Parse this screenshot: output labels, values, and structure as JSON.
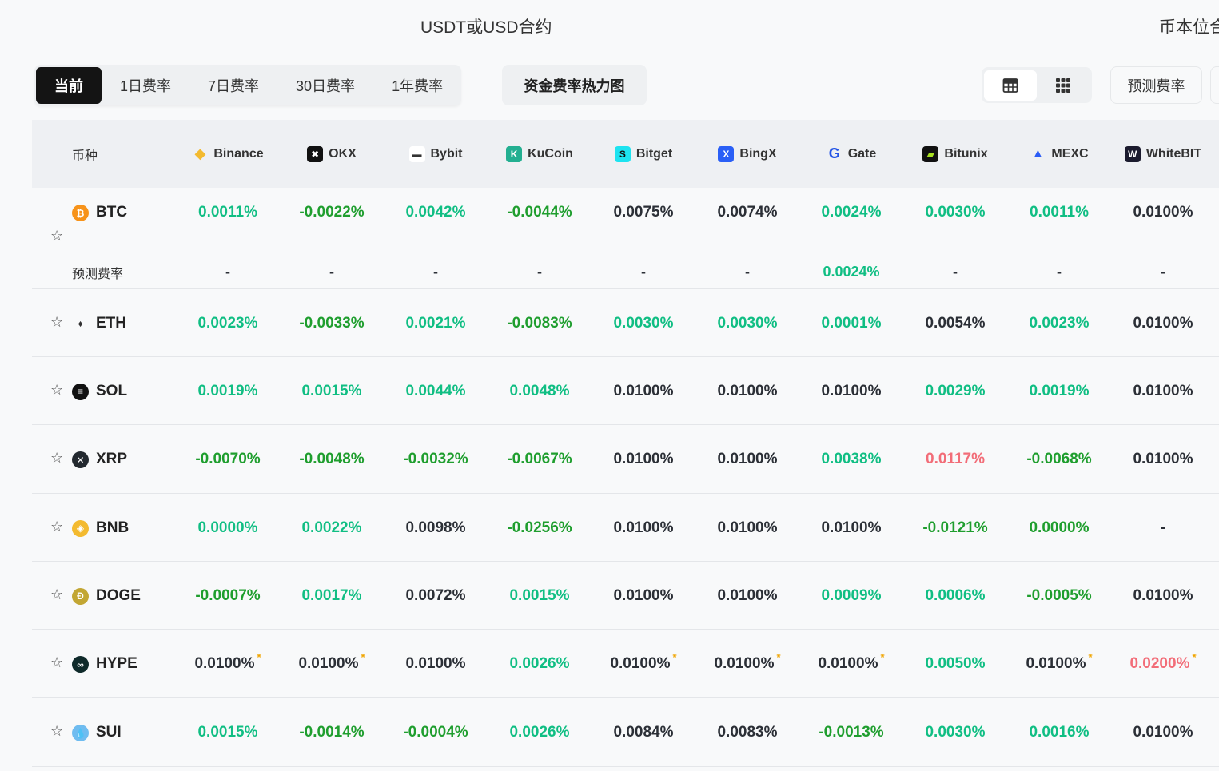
{
  "top_tabs": {
    "usdt": "USDT或USD合约",
    "coin": "币本位合"
  },
  "period_tabs": [
    "当前",
    "1日费率",
    "7日费率",
    "30日费率",
    "1年费率"
  ],
  "heatmap_button": "资金费率热力图",
  "view_icons": [
    "table-view-icon",
    "grid-view-icon"
  ],
  "predict_button": "预测费率",
  "header": {
    "coin": "币种"
  },
  "exchanges": [
    {
      "name": "Binance",
      "color": "#f3ba2f",
      "glyph": "◆"
    },
    {
      "name": "OKX",
      "color": "#111111",
      "glyph": "✖"
    },
    {
      "name": "Bybit",
      "color": "#ffffff",
      "glyph": "▬"
    },
    {
      "name": "KuCoin",
      "color": "#23af91",
      "glyph": "K"
    },
    {
      "name": "Bitget",
      "color": "#1de3f0",
      "glyph": "S"
    },
    {
      "name": "BingX",
      "color": "#2a5ff6",
      "glyph": "X"
    },
    {
      "name": "Gate",
      "color": "#2354e6",
      "glyph": "G"
    },
    {
      "name": "Bitunix",
      "color": "#111111",
      "glyph": "▰"
    },
    {
      "name": "MEXC",
      "color": "#2a5cf6",
      "glyph": "▲"
    },
    {
      "name": "WhiteBIT",
      "color": "#1b1b2e",
      "glyph": "W"
    }
  ],
  "colors": {
    "positive": "#10be83",
    "negative": "#1f9e2e",
    "neutral": "#2b2f36",
    "high": "#f26d78",
    "estimate_marker": "#f0a500"
  },
  "predict_label": "预测费率",
  "rows": [
    {
      "coin": "BTC",
      "icon": "₿",
      "icon_color": "#f7931a",
      "cells": [
        [
          "0.0011%",
          "p"
        ],
        [
          "-0.0022%",
          "n"
        ],
        [
          "0.0042%",
          "p"
        ],
        [
          "-0.0044%",
          "n"
        ],
        [
          "0.0075%",
          "u"
        ],
        [
          "0.0074%",
          "u"
        ],
        [
          "0.0024%",
          "p"
        ],
        [
          "0.0030%",
          "p"
        ],
        [
          "0.0011%",
          "p"
        ],
        [
          "0.0100%",
          "u"
        ]
      ],
      "predicted": [
        [
          "-",
          "u"
        ],
        [
          "-",
          "u"
        ],
        [
          "-",
          "u"
        ],
        [
          "-",
          "u"
        ],
        [
          "-",
          "u"
        ],
        [
          "-",
          "u"
        ],
        [
          "0.0024%",
          "p"
        ],
        [
          "-",
          "u"
        ],
        [
          "-",
          "u"
        ],
        [
          "-",
          "u"
        ]
      ]
    },
    {
      "coin": "ETH",
      "icon": "♦",
      "icon_color": "#f8f9fa",
      "cells": [
        [
          "0.0023%",
          "p"
        ],
        [
          "-0.0033%",
          "n"
        ],
        [
          "0.0021%",
          "p"
        ],
        [
          "-0.0083%",
          "n"
        ],
        [
          "0.0030%",
          "p"
        ],
        [
          "0.0030%",
          "p"
        ],
        [
          "0.0001%",
          "p"
        ],
        [
          "0.0054%",
          "u"
        ],
        [
          "0.0023%",
          "p"
        ],
        [
          "0.0100%",
          "u"
        ]
      ]
    },
    {
      "coin": "SOL",
      "icon": "≡",
      "icon_color": "#111111",
      "cells": [
        [
          "0.0019%",
          "p"
        ],
        [
          "0.0015%",
          "p"
        ],
        [
          "0.0044%",
          "p"
        ],
        [
          "0.0048%",
          "p"
        ],
        [
          "0.0100%",
          "u"
        ],
        [
          "0.0100%",
          "u"
        ],
        [
          "0.0100%",
          "u"
        ],
        [
          "0.0029%",
          "p"
        ],
        [
          "0.0019%",
          "p"
        ],
        [
          "0.0100%",
          "u"
        ]
      ]
    },
    {
      "coin": "XRP",
      "icon": "✕",
      "icon_color": "#23292f",
      "cells": [
        [
          "-0.0070%",
          "n"
        ],
        [
          "-0.0048%",
          "n"
        ],
        [
          "-0.0032%",
          "n"
        ],
        [
          "-0.0067%",
          "n"
        ],
        [
          "0.0100%",
          "u"
        ],
        [
          "0.0100%",
          "u"
        ],
        [
          "0.0038%",
          "p"
        ],
        [
          "0.0117%",
          "r"
        ],
        [
          "-0.0068%",
          "n"
        ],
        [
          "0.0100%",
          "u"
        ]
      ]
    },
    {
      "coin": "BNB",
      "icon": "◈",
      "icon_color": "#f3ba2f",
      "cells": [
        [
          "0.0000%",
          "p"
        ],
        [
          "0.0022%",
          "p"
        ],
        [
          "0.0098%",
          "u"
        ],
        [
          "-0.0256%",
          "n"
        ],
        [
          "0.0100%",
          "u"
        ],
        [
          "0.0100%",
          "u"
        ],
        [
          "0.0100%",
          "u"
        ],
        [
          "-0.0121%",
          "n"
        ],
        [
          "0.0000%",
          "n"
        ],
        [
          "-",
          "u"
        ]
      ]
    },
    {
      "coin": "DOGE",
      "icon": "Ð",
      "icon_color": "#c2a633",
      "cells": [
        [
          "-0.0007%",
          "n"
        ],
        [
          "0.0017%",
          "p"
        ],
        [
          "0.0072%",
          "u"
        ],
        [
          "0.0015%",
          "p"
        ],
        [
          "0.0100%",
          "u"
        ],
        [
          "0.0100%",
          "u"
        ],
        [
          "0.0009%",
          "p"
        ],
        [
          "0.0006%",
          "p"
        ],
        [
          "-0.0005%",
          "n"
        ],
        [
          "0.0100%",
          "u"
        ]
      ]
    },
    {
      "coin": "HYPE",
      "icon": "∞",
      "icon_color": "#0f2a2a",
      "cells": [
        [
          "0.0100%",
          "u",
          "*"
        ],
        [
          "0.0100%",
          "u",
          "*"
        ],
        [
          "0.0100%",
          "u"
        ],
        [
          "0.0026%",
          "p"
        ],
        [
          "0.0100%",
          "u",
          "*"
        ],
        [
          "0.0100%",
          "u",
          "*"
        ],
        [
          "0.0100%",
          "u",
          "*"
        ],
        [
          "0.0050%",
          "p"
        ],
        [
          "0.0100%",
          "u",
          "*"
        ],
        [
          "0.0200%",
          "r",
          "*"
        ]
      ]
    },
    {
      "coin": "SUI",
      "icon": "💧",
      "icon_color": "#6fbcf0",
      "cells": [
        [
          "0.0015%",
          "p"
        ],
        [
          "-0.0014%",
          "n"
        ],
        [
          "-0.0004%",
          "n"
        ],
        [
          "0.0026%",
          "p"
        ],
        [
          "0.0084%",
          "u"
        ],
        [
          "0.0083%",
          "u"
        ],
        [
          "-0.0013%",
          "n"
        ],
        [
          "0.0030%",
          "p"
        ],
        [
          "0.0016%",
          "p"
        ],
        [
          "0.0100%",
          "u"
        ]
      ]
    }
  ]
}
